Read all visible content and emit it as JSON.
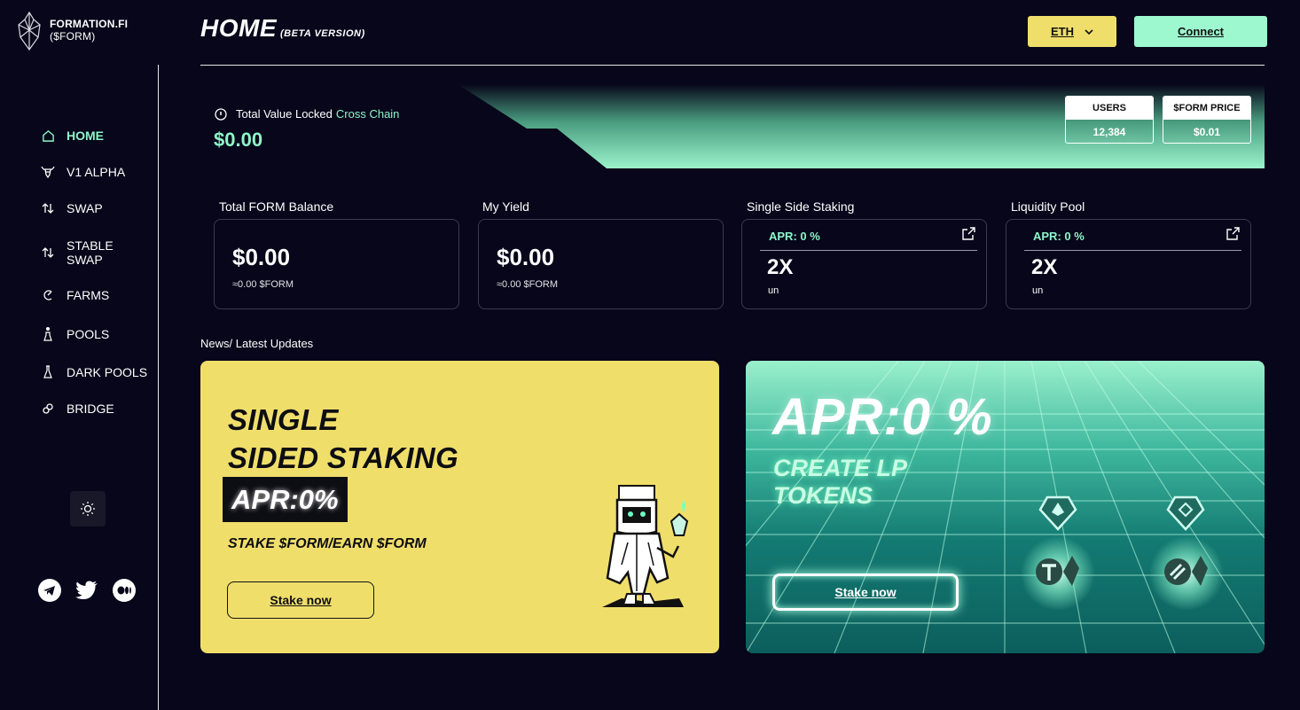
{
  "brand": {
    "name": "FORMATION.FI",
    "ticker": "($FORM)"
  },
  "nav": {
    "items": [
      {
        "label": "HOME",
        "icon": "home-icon",
        "active": true
      },
      {
        "label": "V1 ALPHA",
        "icon": "bull-icon"
      },
      {
        "label": "SWAP",
        "icon": "swap-arrows-icon"
      },
      {
        "label": "STABLE",
        "label2": "SWAP",
        "icon": "swap-arrows-icon"
      },
      {
        "label": "FARMS",
        "icon": "farm-icon"
      },
      {
        "label": "POOLS",
        "icon": "pool-icon"
      },
      {
        "label": "DARK POOLS",
        "icon": "flask-icon"
      },
      {
        "label": "BRIDGE",
        "icon": "link-icon"
      }
    ],
    "theme_icon": "sun-icon",
    "socials": [
      "telegram-icon",
      "twitter-icon",
      "medium-icon"
    ]
  },
  "header": {
    "title": "HOME",
    "subtitle": "(BETA VERSION)",
    "network": "ETH",
    "connect": "Connect"
  },
  "tvl": {
    "label": "Total Value Locked",
    "label_highlight": "Cross Chain",
    "value": "$0.00",
    "users_label": "USERS",
    "users_value": "12,384",
    "price_label": "$FORM PRICE",
    "price_value": "$0.01"
  },
  "cards": {
    "balance": {
      "label": "Total FORM Balance",
      "value": "$0.00",
      "sub": "≈0.00 $FORM"
    },
    "yield": {
      "label": "My Yield",
      "value": "$0.00",
      "sub": "≈0.00 $FORM"
    },
    "staking": {
      "label": "Single Side Staking",
      "apr": "APR: 0 %",
      "mult": "2X",
      "unit": "un"
    },
    "lp": {
      "label": "Liquidity Pool",
      "apr": "APR: 0 %",
      "mult": "2X",
      "unit": "un"
    }
  },
  "news": {
    "label": "News/ Latest Updates",
    "staking_promo": {
      "line1": "SINGLE",
      "line2": "SIDED STAKING",
      "apr": "APR:0%",
      "tagline": "STAKE $FORM/EARN $FORM",
      "button": "Stake now"
    },
    "lp_promo": {
      "apr": "APR:0 %",
      "line1": "CREATE LP",
      "line2": "TOKENS",
      "button": "Stake now"
    }
  },
  "colors": {
    "background": "#07061a",
    "accent_mint": "#8ef5c9",
    "accent_yellow": "#f0de6b",
    "connect_bg": "#9df8cf"
  }
}
